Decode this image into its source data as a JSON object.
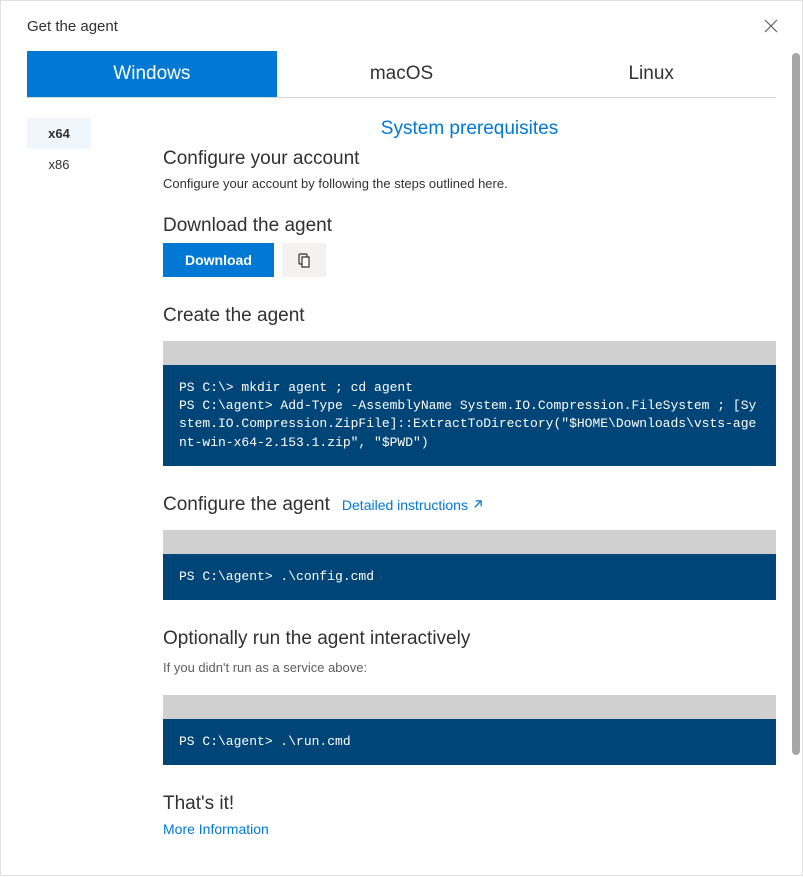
{
  "dialog": {
    "title": "Get the agent"
  },
  "tabs": [
    {
      "label": "Windows",
      "active": true
    },
    {
      "label": "macOS",
      "active": false
    },
    {
      "label": "Linux",
      "active": false
    }
  ],
  "arch": [
    {
      "label": "x64",
      "active": true
    },
    {
      "label": "x86",
      "active": false
    }
  ],
  "prereq_link": "System prerequisites",
  "sections": {
    "configure_account": {
      "heading": "Configure your account",
      "desc": "Configure your account by following the steps outlined here."
    },
    "download": {
      "heading": "Download the agent",
      "button": "Download"
    },
    "create_agent": {
      "heading": "Create the agent",
      "code": "PS C:\\> mkdir agent ; cd agent\nPS C:\\agent> Add-Type -AssemblyName System.IO.Compression.FileSystem ; [System.IO.Compression.ZipFile]::ExtractToDirectory(\"$HOME\\Downloads\\vsts-agent-win-x64-2.153.1.zip\", \"$PWD\")"
    },
    "configure_agent": {
      "heading": "Configure the agent",
      "detailed": "Detailed instructions",
      "code": "PS C:\\agent> .\\config.cmd"
    },
    "run_agent": {
      "heading": "Optionally run the agent interactively",
      "note": "If you didn't run as a service above:",
      "code": "PS C:\\agent> .\\run.cmd"
    },
    "thats_it": {
      "heading": "That's it!",
      "more_info": "More Information"
    }
  }
}
